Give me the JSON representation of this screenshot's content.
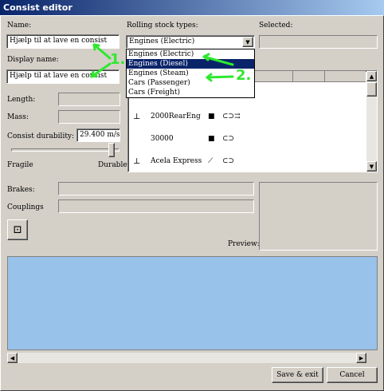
{
  "window": {
    "title": "Consist editor"
  },
  "form": {
    "name_label": "Name:",
    "name_value": "Hjælp til at lave en consist",
    "display_name_label": "Display name:",
    "display_name_value": "Hjælp til at lave en consist",
    "length_label": "Length:",
    "mass_label": "Mass:",
    "durability_label": "Consist durability:",
    "durability_value": "29.400 m/s/s",
    "slider_level": 0.95,
    "fragile_label": "Fragile",
    "durable_label": "Durable",
    "brakes_label": "Brakes:",
    "couplings_label": "Couplings",
    "preview_label": "Preview:"
  },
  "stock": {
    "types_label": "Rolling stock types:",
    "selected_label": "Selected:",
    "dropdown_value": "Engines (Electric)",
    "options": [
      "Engines (Electric)",
      "Engines (Diesel)",
      "Engines (Steam)",
      "Cars (Passenger)",
      "Cars (Freight)"
    ],
    "highlighted_option": "Engines (Diesel)",
    "list": [
      {
        "name": "2000RearEng"
      },
      {
        "name": "30000"
      },
      {
        "name": "Acela Express"
      }
    ]
  },
  "buttons": {
    "save_exit": "Save & exit",
    "cancel": "Cancel"
  },
  "annotations": {
    "one": "1.",
    "two": "2."
  },
  "colors": {
    "annotation": "#2ee82e",
    "highlight": "#0a246a",
    "preview_bg": "#99c2ea"
  }
}
